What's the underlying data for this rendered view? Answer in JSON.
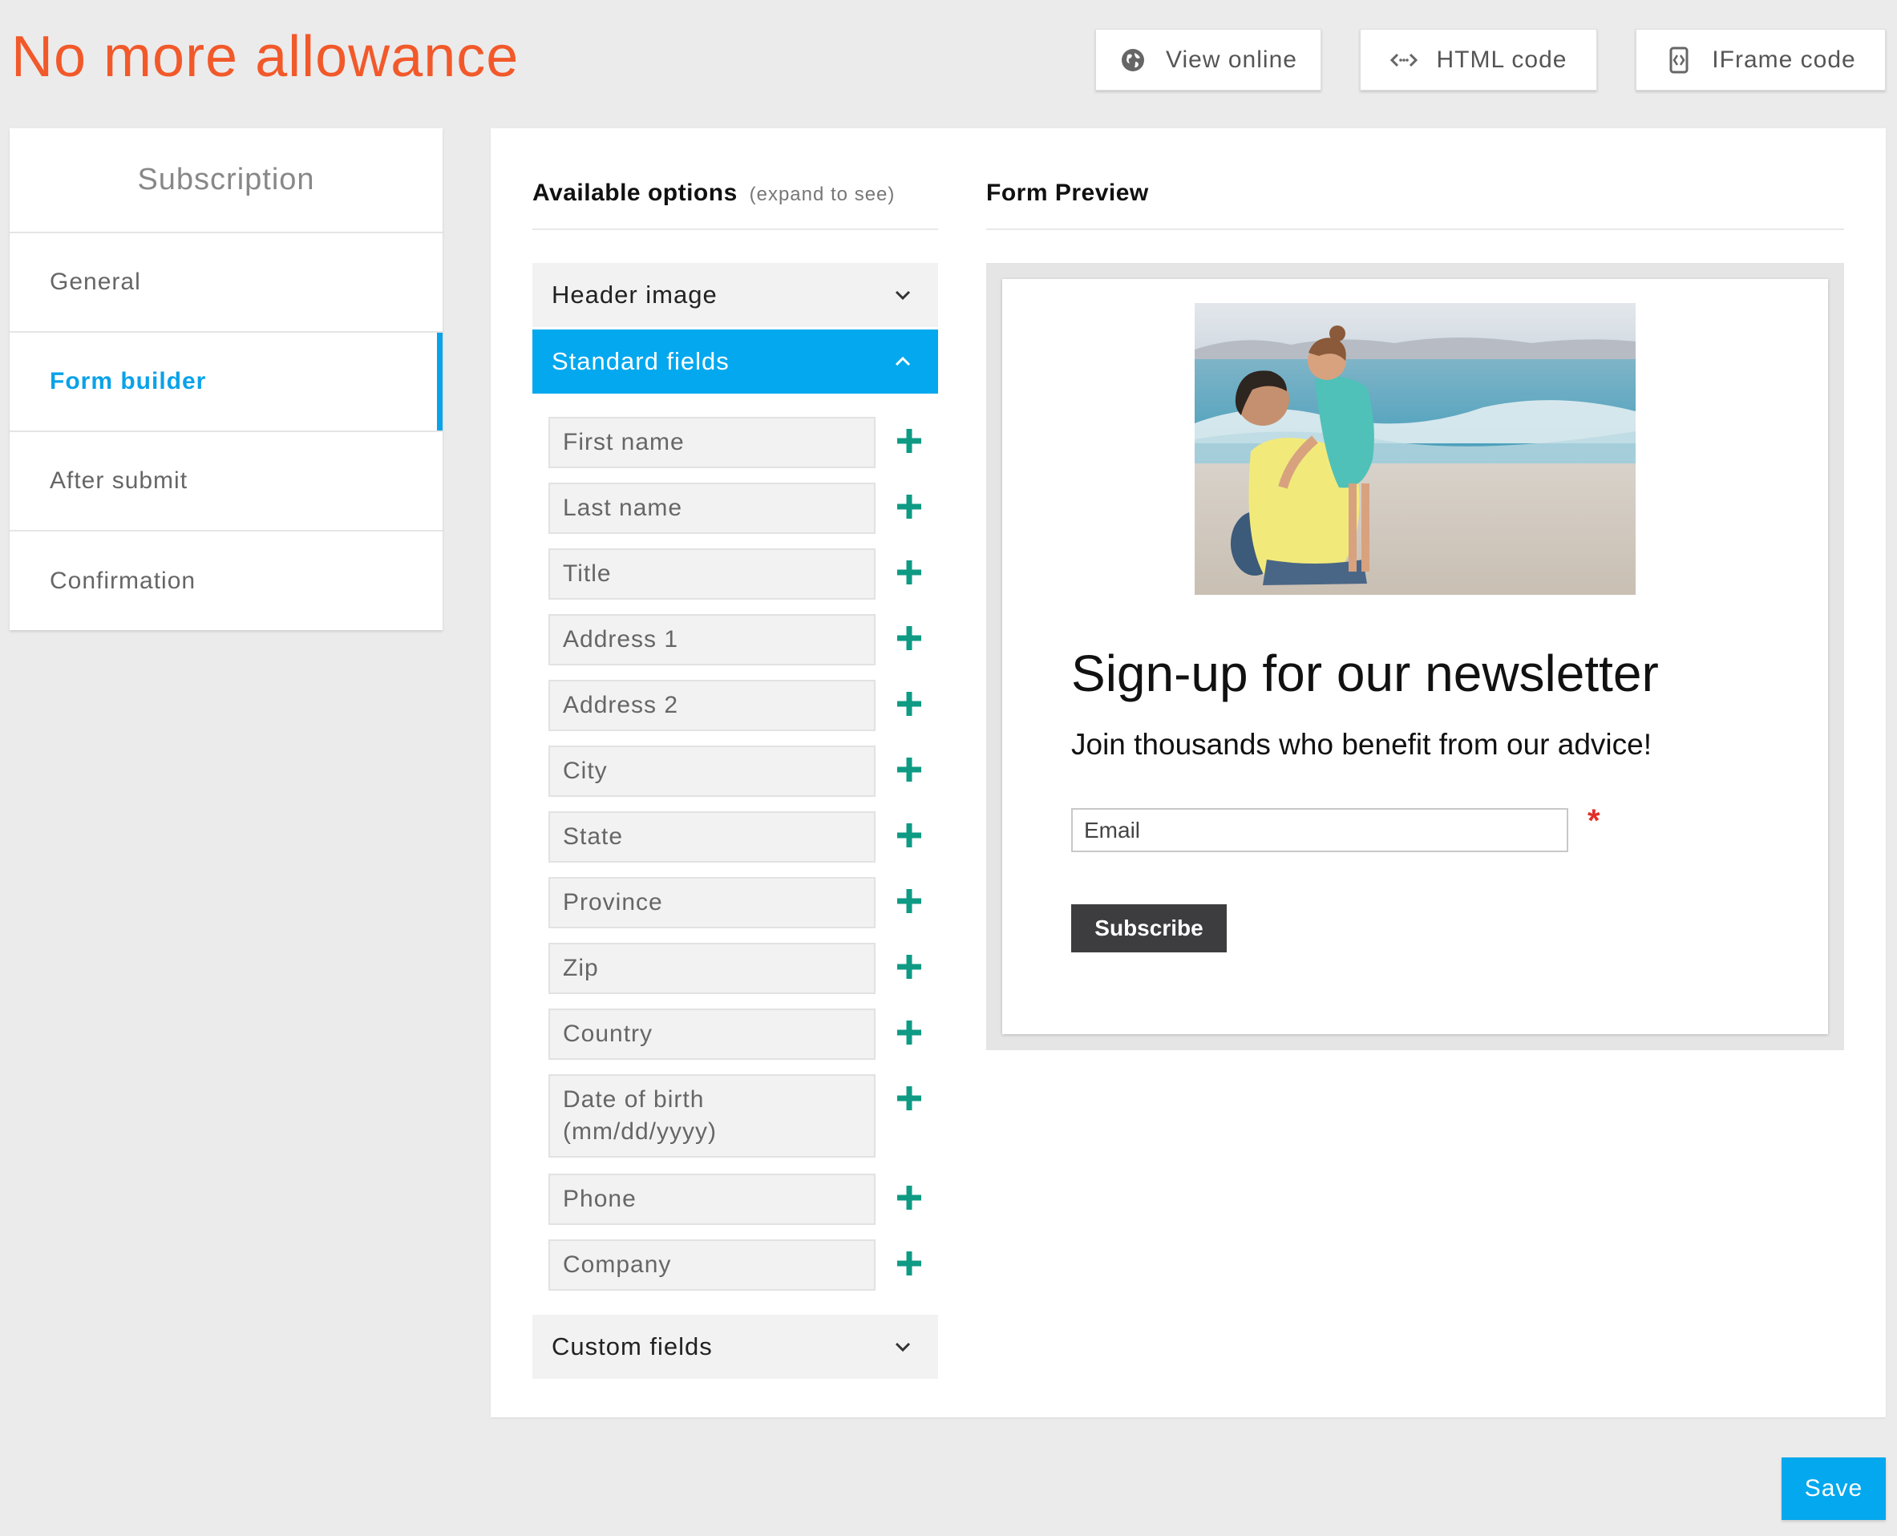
{
  "header": {
    "title": "No more allowance",
    "buttons": {
      "view_online": {
        "label": "View online",
        "icon": "globe-icon"
      },
      "html_code": {
        "label": "HTML code",
        "icon": "code-icon"
      },
      "iframe_code": {
        "label": "IFrame code",
        "icon": "iframe-icon"
      }
    }
  },
  "sidebar": {
    "heading": "Subscription",
    "items": [
      {
        "label": "General",
        "active": false
      },
      {
        "label": "Form builder",
        "active": true
      },
      {
        "label": "After submit",
        "active": false
      },
      {
        "label": "Confirmation",
        "active": false
      }
    ]
  },
  "options": {
    "title": "Available options",
    "subtitle": "(expand to see)",
    "sections": {
      "header_image": {
        "label": "Header image",
        "expanded": false
      },
      "standard_fields": {
        "label": "Standard fields",
        "expanded": true
      },
      "custom_fields": {
        "label": "Custom fields",
        "expanded": false
      }
    },
    "fields": [
      "First name",
      "Last name",
      "Title",
      "Address 1",
      "Address 2",
      "City",
      "State",
      "Province",
      "Zip",
      "Country",
      "Date of birth (mm/dd/yyyy)",
      "Phone",
      "Company"
    ]
  },
  "preview": {
    "title": "Form Preview",
    "heading": "Sign-up for our newsletter",
    "subheading": "Join thousands who benefit from our advice!",
    "email_placeholder": "Email",
    "required_mark": "*",
    "submit_label": "Subscribe"
  },
  "footer": {
    "save_label": "Save"
  },
  "colors": {
    "brand_title": "#f2592a",
    "accent": "#04a8ee",
    "plus": "#0f9a84",
    "submit": "#3d3d3f"
  }
}
